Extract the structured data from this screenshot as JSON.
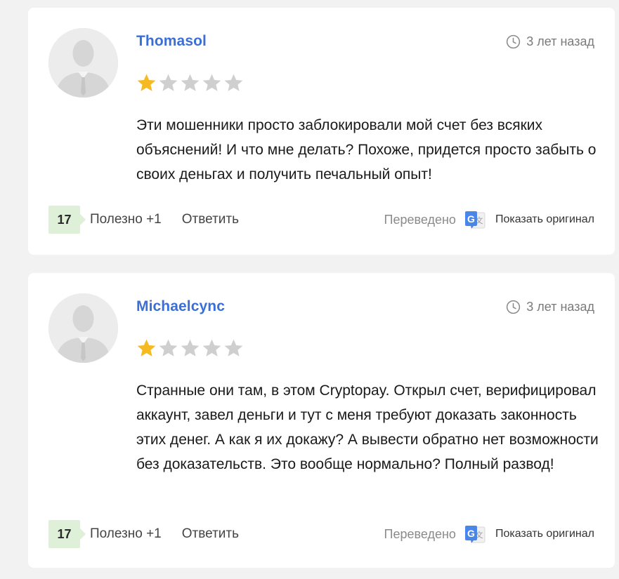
{
  "reviews": [
    {
      "author": "Thomasol",
      "date": "3 лет назад",
      "rating": 1,
      "rating_max": 5,
      "text": "Эти мошенники просто заблокировали мой счет без всяких объяснений! И что мне делать? Похоже, придется просто забыть о своих деньгах и получить печальный опыт!",
      "votes": "17",
      "useful_label": "Полезно +1",
      "reply_label": "Ответить",
      "translated_label": "Переведено",
      "show_original_label": "Показать оригинал"
    },
    {
      "author": "Michaelcync",
      "date": "3 лет назад",
      "rating": 1,
      "rating_max": 5,
      "text": "Странные они там, в этом Cryptopay. Открыл счет, верифицировал аккаунт, завел деньги и тут с меня требуют доказать законность этих денег. А как я их докажу? А вывести обратно нет возможности без доказательств. Это вообще нормально? Полный развод!",
      "votes": "17",
      "useful_label": "Полезно +1",
      "reply_label": "Ответить",
      "translated_label": "Переведено",
      "show_original_label": "Показать оригинал"
    }
  ],
  "colors": {
    "page_background": "#f2f2f2",
    "author_link": "#3a6fd8",
    "star_filled": "#f5b921",
    "star_empty": "#cfcfcf",
    "vote_badge": "#dff0d8"
  },
  "icons": {
    "date": "clock-icon",
    "rating": "star-icon",
    "translate": "google-translate-icon",
    "avatar": "user-silhouette-icon"
  }
}
